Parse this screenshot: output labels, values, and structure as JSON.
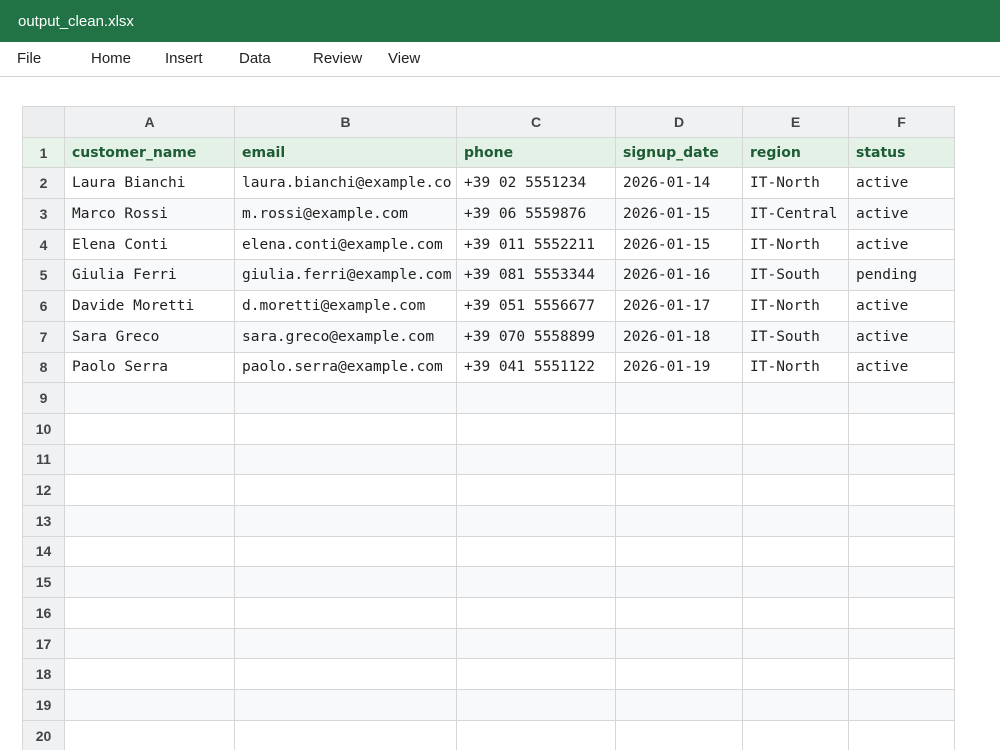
{
  "window": {
    "title": "output_clean.xlsx"
  },
  "menu": {
    "file": "File",
    "home": "Home",
    "insert": "Insert",
    "data": "Data",
    "review": "Review",
    "view": "View"
  },
  "colors": {
    "titlebar": "#217346",
    "header_row_bg": "#e3f1e6",
    "header_row_text": "#1e5c35"
  },
  "sheet": {
    "columns": [
      "A",
      "B",
      "C",
      "D",
      "E",
      "F"
    ],
    "header_row": {
      "number": "1",
      "cells": [
        "customer_name",
        "email",
        "phone",
        "signup_date",
        "region",
        "status"
      ]
    },
    "data_rows": [
      {
        "number": "2",
        "cells": [
          "Laura Bianchi",
          "laura.bianchi@example.co",
          "+39 02 5551234",
          "2026-01-14",
          "IT-North",
          "active"
        ]
      },
      {
        "number": "3",
        "cells": [
          "Marco Rossi",
          "m.rossi@example.com",
          "+39 06 5559876",
          "2026-01-15",
          "IT-Central",
          "active"
        ]
      },
      {
        "number": "4",
        "cells": [
          "Elena Conti",
          "elena.conti@example.com",
          "+39 011 5552211",
          "2026-01-15",
          "IT-North",
          "active"
        ]
      },
      {
        "number": "5",
        "cells": [
          "Giulia Ferri",
          "giulia.ferri@example.com",
          "+39 081 5553344",
          "2026-01-16",
          "IT-South",
          "pending"
        ]
      },
      {
        "number": "6",
        "cells": [
          "Davide Moretti",
          "d.moretti@example.com",
          "+39 051 5556677",
          "2026-01-17",
          "IT-North",
          "active"
        ]
      },
      {
        "number": "7",
        "cells": [
          "Sara Greco",
          "sara.greco@example.com",
          "+39 070 5558899",
          "2026-01-18",
          "IT-South",
          "active"
        ]
      },
      {
        "number": "8",
        "cells": [
          "Paolo Serra",
          "paolo.serra@example.com",
          "+39 041 5551122",
          "2026-01-19",
          "IT-North",
          "active"
        ]
      }
    ],
    "empty_rows": [
      "9",
      "10",
      "11",
      "12",
      "13",
      "14",
      "15",
      "16",
      "17",
      "18",
      "19",
      "20"
    ]
  }
}
